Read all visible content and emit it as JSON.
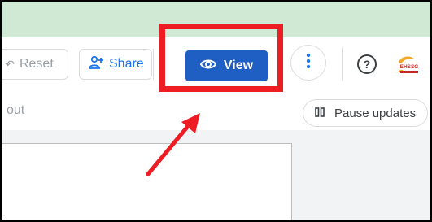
{
  "toolbar": {
    "reset_label": "Reset",
    "share_label": "Share",
    "view_label": "View"
  },
  "subbar": {
    "partial_text": "out",
    "pause_label": "Pause updates"
  },
  "avatar": {
    "text": "EHSSG"
  },
  "icons": {
    "reset": "undo-icon",
    "share": "add-person-icon",
    "view": "eye-icon",
    "more": "more-vertical-icon",
    "help": "help-circle-icon",
    "pause": "pause-icon"
  },
  "colors": {
    "accent": "#1f5fc4",
    "highlight": "#ee1d23",
    "top_bar": "#cfe9d4"
  }
}
